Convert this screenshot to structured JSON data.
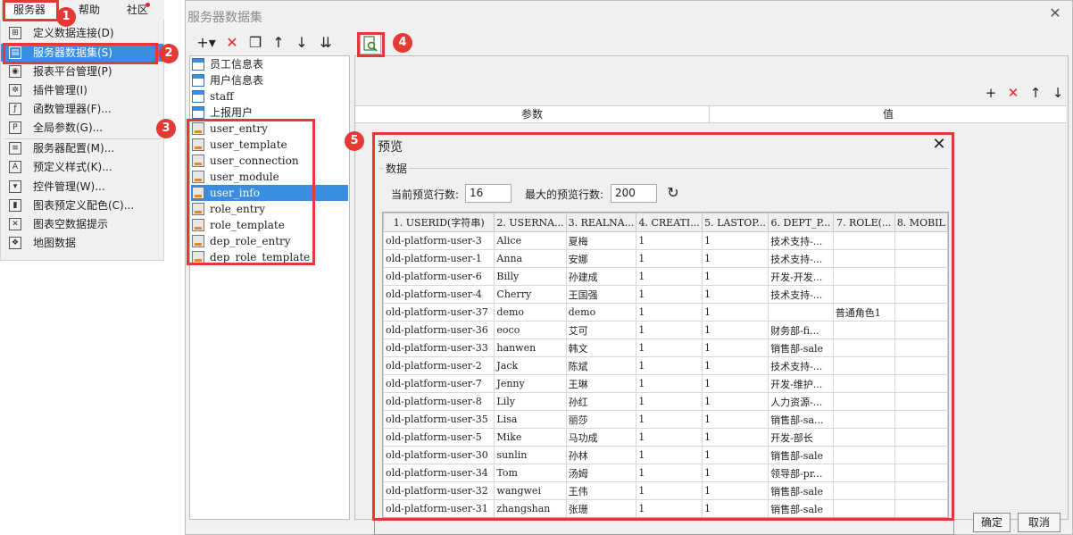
{
  "menu": {
    "server": "服务器",
    "help": "帮助",
    "community": "社区",
    "items": [
      {
        "label": "定义数据连接(D)",
        "icon": "data-connection-icon",
        "glyph": "⊞"
      },
      {
        "label": "服务器数据集(S)",
        "icon": "server-dataset-icon",
        "glyph": "▤"
      },
      {
        "label": "报表平台管理(P)",
        "icon": "platform-user-icon",
        "glyph": "◉"
      },
      {
        "label": "插件管理(I)",
        "icon": "plugin-icon",
        "glyph": "✲"
      },
      {
        "label": "函数管理器(F)...",
        "icon": "function-icon",
        "glyph": "ƒ"
      },
      {
        "label": "全局参数(G)...",
        "icon": "parameter-icon",
        "glyph": "P"
      },
      {
        "label": "服务器配置(M)...",
        "icon": "server-config-icon",
        "glyph": "≡"
      },
      {
        "label": "预定义样式(K)...",
        "icon": "style-icon",
        "glyph": "A"
      },
      {
        "label": "控件管理(W)...",
        "icon": "widget-icon",
        "glyph": "▾"
      },
      {
        "label": "图表预定义配色(C)...",
        "icon": "chart-color-icon",
        "glyph": "▮"
      },
      {
        "label": "图表空数据提示",
        "icon": "chart-empty-icon",
        "glyph": "✕"
      },
      {
        "label": "地图数据",
        "icon": "map-data-icon",
        "glyph": "❖"
      }
    ]
  },
  "callouts": [
    "1",
    "2",
    "3",
    "4",
    "5"
  ],
  "dialog": {
    "title": "服务器数据集",
    "close": "✕",
    "toolbar": {
      "add": "+▾",
      "delete": "✕",
      "copy": "❐",
      "up": "↑",
      "down": "↓",
      "sort": "⇊"
    },
    "tree": [
      {
        "label": "员工信息表",
        "type": "table"
      },
      {
        "label": "用户信息表",
        "type": "table"
      },
      {
        "label": "staff",
        "type": "table"
      },
      {
        "label": "上报用户",
        "type": "table"
      },
      {
        "label": "user_entry",
        "type": "db"
      },
      {
        "label": "user_template",
        "type": "db"
      },
      {
        "label": "user_connection",
        "type": "db"
      },
      {
        "label": "user_module",
        "type": "db"
      },
      {
        "label": "user_info",
        "type": "db"
      },
      {
        "label": "role_entry",
        "type": "db"
      },
      {
        "label": "role_template",
        "type": "db"
      },
      {
        "label": "dep_role_entry",
        "type": "db"
      },
      {
        "label": "dep_role_template",
        "type": "db"
      }
    ],
    "param_toolbar": {
      "add": "+",
      "delete": "✕",
      "up": "↑",
      "down": "↓"
    },
    "param_header": {
      "param": "参数",
      "value": "值"
    },
    "ok": "确定",
    "cancel": "取消"
  },
  "preview": {
    "title": "预览",
    "close": "✕",
    "group": "数据",
    "current_label": "当前预览行数:",
    "current_value": "16",
    "max_label": "最大的预览行数:",
    "max_value": "200",
    "columns": [
      "1. USERID(字符串)",
      "2. USERNA...",
      "3. REALNA...",
      "4. CREATI...",
      "5. LASTOP...",
      "6. DEPT_P...",
      "7. ROLE(...",
      "8. MOBIL"
    ],
    "rows": [
      [
        "old-platform-user-3",
        "Alice",
        "夏梅",
        "1",
        "1",
        "技术支持-...",
        "",
        ""
      ],
      [
        "old-platform-user-1",
        "Anna",
        "安娜",
        "1",
        "1",
        "技术支持-...",
        "",
        ""
      ],
      [
        "old-platform-user-6",
        "Billy",
        "孙建成",
        "1",
        "1",
        "开发-开发...",
        "",
        ""
      ],
      [
        "old-platform-user-4",
        "Cherry",
        "王国强",
        "1",
        "1",
        "技术支持-...",
        "",
        ""
      ],
      [
        "old-platform-user-37",
        "demo",
        "demo",
        "1",
        "1",
        "",
        "普通角色1",
        ""
      ],
      [
        "old-platform-user-36",
        "eoco",
        "艾可",
        "1",
        "1",
        "财务部-fi...",
        "",
        ""
      ],
      [
        "old-platform-user-33",
        "hanwen",
        "韩文",
        "1",
        "1",
        "销售部-sale",
        "",
        ""
      ],
      [
        "old-platform-user-2",
        "Jack",
        "陈斌",
        "1",
        "1",
        "技术支持-...",
        "",
        ""
      ],
      [
        "old-platform-user-7",
        "Jenny",
        "王琳",
        "1",
        "1",
        "开发-维护...",
        "",
        ""
      ],
      [
        "old-platform-user-8",
        "Lily",
        "孙红",
        "1",
        "1",
        "人力资源-...",
        "",
        ""
      ],
      [
        "old-platform-user-35",
        "Lisa",
        "丽莎",
        "1",
        "1",
        "销售部-sa...",
        "",
        ""
      ],
      [
        "old-platform-user-5",
        "Mike",
        "马功成",
        "1",
        "1",
        "开发-部长",
        "",
        ""
      ],
      [
        "old-platform-user-30",
        "sunlin",
        "孙林",
        "1",
        "1",
        "销售部-sale",
        "",
        ""
      ],
      [
        "old-platform-user-34",
        "Tom",
        "汤姆",
        "1",
        "1",
        "领导部-pr...",
        "",
        ""
      ],
      [
        "old-platform-user-32",
        "wangwei",
        "王伟",
        "1",
        "1",
        "销售部-sale",
        "",
        ""
      ],
      [
        "old-platform-user-31",
        "zhangshan",
        "张珊",
        "1",
        "1",
        "销售部-sale",
        "",
        ""
      ]
    ]
  }
}
